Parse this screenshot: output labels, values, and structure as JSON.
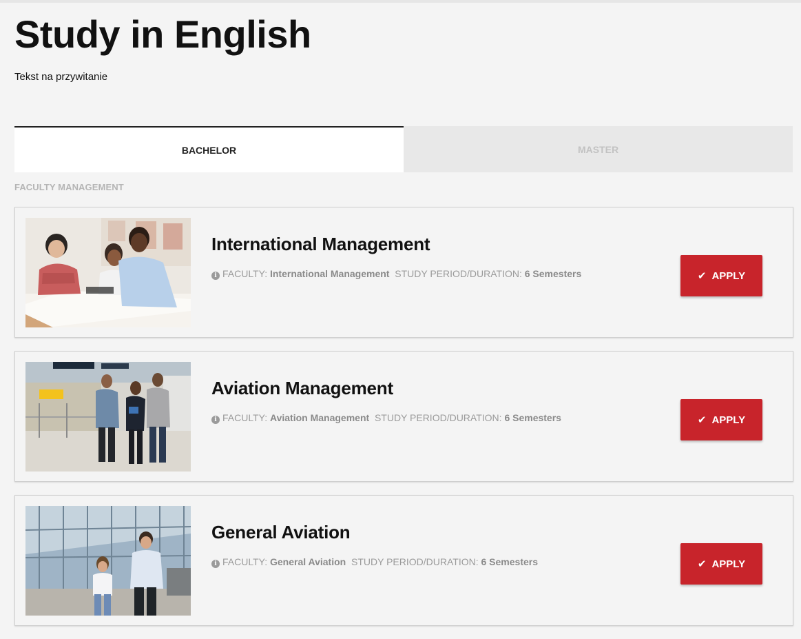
{
  "page": {
    "title": "Study in English",
    "welcome": "Tekst na przywitanie"
  },
  "tabs": [
    {
      "label": "BACHELOR",
      "active": true
    },
    {
      "label": "MASTER",
      "active": false
    }
  ],
  "section": {
    "label": "FACULTY MANAGEMENT"
  },
  "labels": {
    "faculty": "FACULTY:",
    "duration": "STUDY PERIOD/DURATION:",
    "apply": "APPLY"
  },
  "icons": {
    "info": "info-circle-icon",
    "apply": "check-icon"
  },
  "colors": {
    "accent": "#c8242b",
    "muted_text": "#9a9a9a",
    "inactive_tab_text": "#c2c2c2"
  },
  "programs": [
    {
      "name": "International Management",
      "faculty": "International Management",
      "duration": "6 Semesters"
    },
    {
      "name": "Aviation Management",
      "faculty": "Aviation Management",
      "duration": "6 Semesters"
    },
    {
      "name": "General Aviation",
      "faculty": "General Aviation",
      "duration": "6 Semesters"
    }
  ]
}
